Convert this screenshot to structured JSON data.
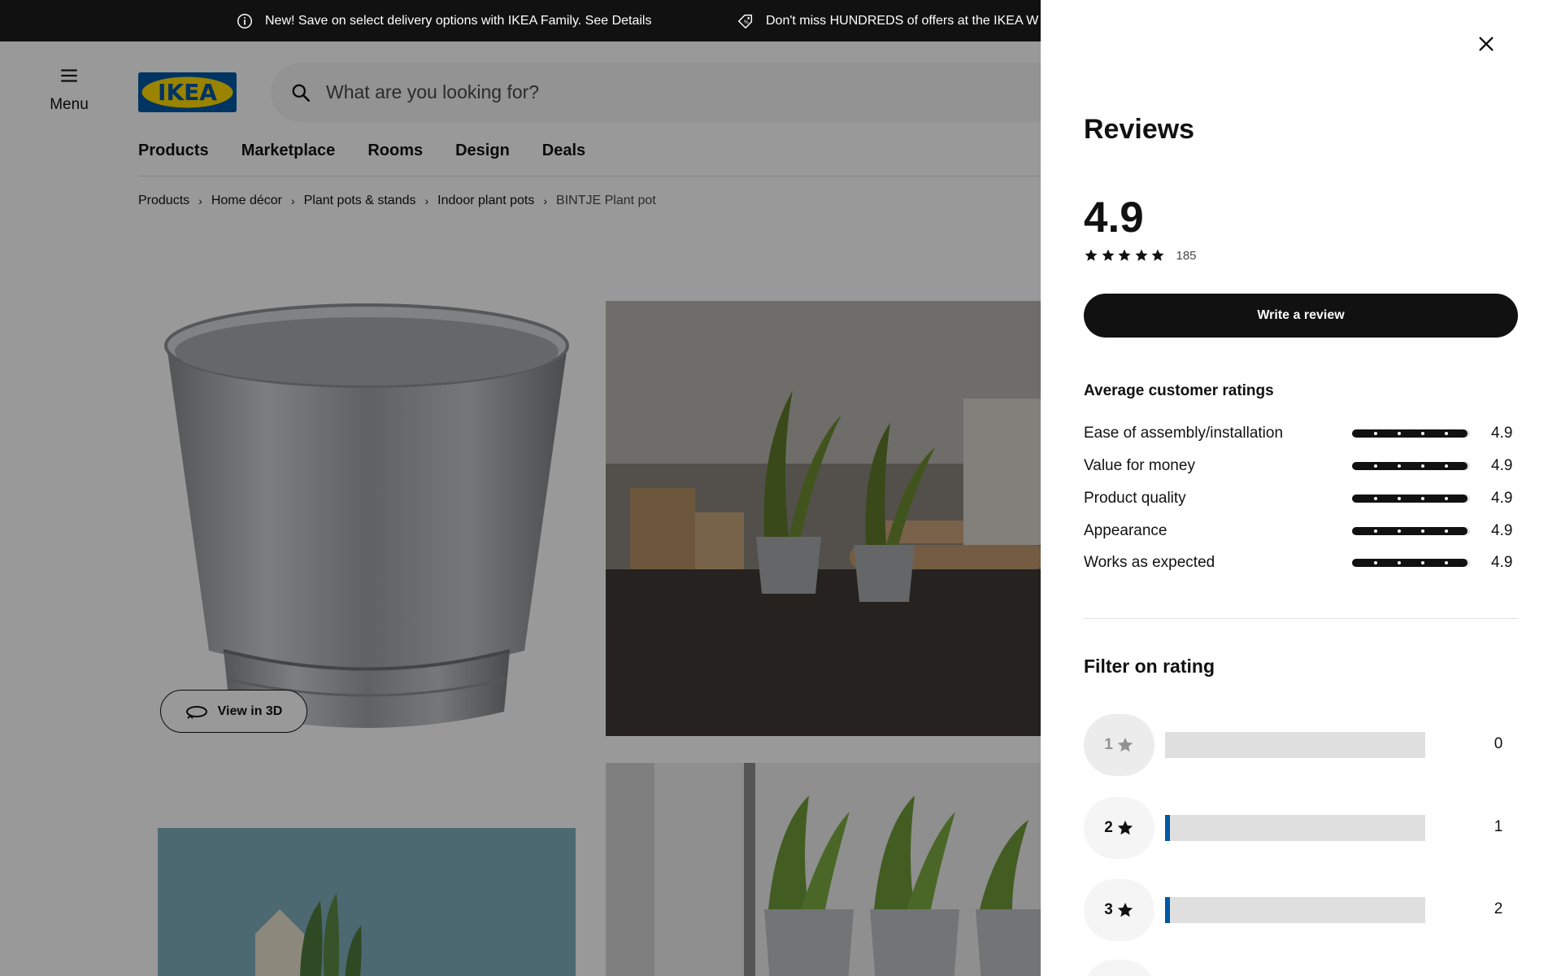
{
  "topbar": {
    "message1": "New! Save on select delivery options with IKEA Family. See Details",
    "message2": "Don't miss HUNDREDS of offers at the IKEA W",
    "icon1": "info-icon",
    "icon2": "tag-icon"
  },
  "header": {
    "menu_label": "Menu",
    "logo_text": "IKEA",
    "search_placeholder": "What are you looking for?"
  },
  "nav": {
    "items": [
      "Products",
      "Marketplace",
      "Rooms",
      "Design",
      "Deals"
    ]
  },
  "breadcrumb": {
    "items": [
      "Products",
      "Home décor",
      "Plant pots & stands",
      "Indoor plant pots",
      "BINTJE Plant pot"
    ]
  },
  "gallery": {
    "view3d_label": "View in 3D"
  },
  "reviews": {
    "title": "Reviews",
    "score": "4.9",
    "stars": 5,
    "count": "185",
    "write_label": "Write a review",
    "avg_title": "Average customer ratings",
    "ratings": [
      {
        "label": "Ease of assembly/installation",
        "value": "4.9",
        "fraction": 0.98
      },
      {
        "label": "Value for money",
        "value": "4.9",
        "fraction": 0.98
      },
      {
        "label": "Product quality",
        "value": "4.9",
        "fraction": 0.98
      },
      {
        "label": "Appearance",
        "value": "4.9",
        "fraction": 0.98
      },
      {
        "label": "Works as expected",
        "value": "4.9",
        "fraction": 0.98
      }
    ],
    "filter_title": "Filter on rating",
    "filters": [
      {
        "stars": "1",
        "count": "0",
        "disabled": true
      },
      {
        "stars": "2",
        "count": "1",
        "disabled": false
      },
      {
        "stars": "3",
        "count": "2",
        "disabled": false
      }
    ],
    "colors": {
      "bar_fill": "#0058a3",
      "track": "#dfdfdf",
      "ink": "#111111"
    }
  }
}
